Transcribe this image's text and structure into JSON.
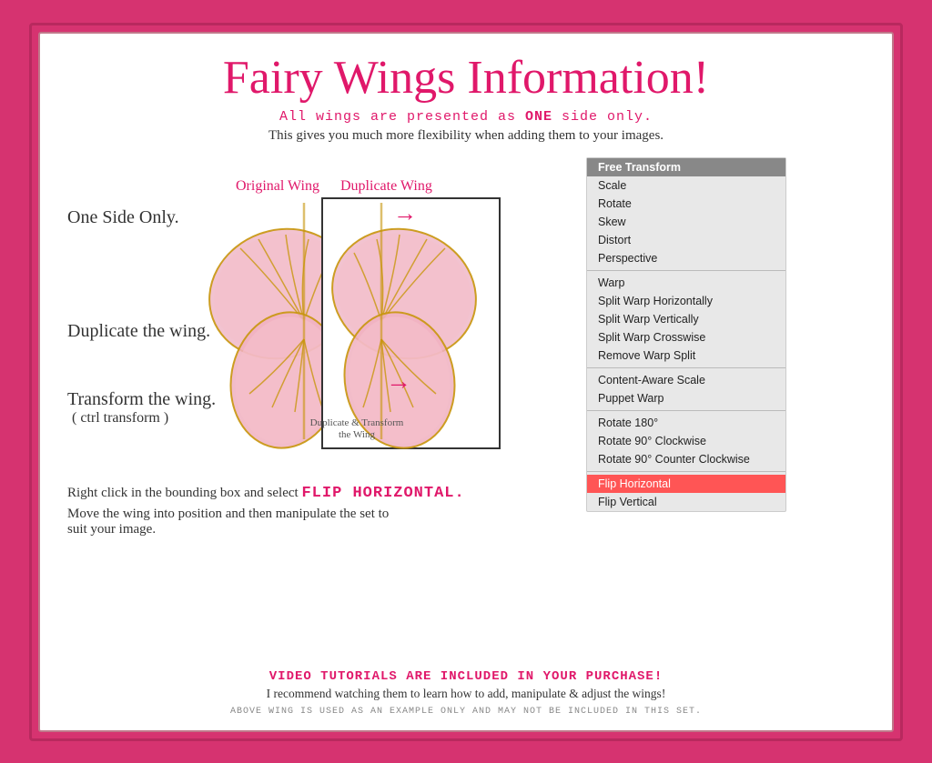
{
  "page": {
    "title": "Fairy Wings Information!",
    "subtitle": "All wings are presented as ONE side only.",
    "description": "This gives you much more flexibility when adding them to your images.",
    "labels": {
      "one_side": "One Side Only.",
      "duplicate": "Duplicate the wing.",
      "transform": "Transform the wing.",
      "transform_sub": "( ctrl transform )",
      "duplicate_transform": "Duplicate & Transform\nthe Wing"
    },
    "wing_labels": {
      "original": "Original Wing",
      "duplicate": "Duplicate Wing"
    },
    "flip_line": "Right click in the bounding box and select",
    "flip_highlight": "FLIP HORIZONTAL.",
    "move_line": "Move the wing into position and then manipulate the set to\nsuit your image.",
    "video_line": "VIDEO TUTORIALS ARE INCLUDED IN YOUR PURCHASE!",
    "recommend_line": "I recommend watching them to learn how to add, manipulate & adjust the wings!",
    "footer": "ABOVE WING IS USED AS AN EXAMPLE ONLY AND MAY NOT BE INCLUDED IN THIS SET."
  },
  "context_menu": {
    "items": [
      {
        "label": "Free Transform",
        "type": "highlighted"
      },
      {
        "label": "Scale",
        "type": "normal"
      },
      {
        "label": "Rotate",
        "type": "normal"
      },
      {
        "label": "Skew",
        "type": "normal"
      },
      {
        "label": "Distort",
        "type": "normal"
      },
      {
        "label": "Perspective",
        "type": "normal"
      },
      {
        "type": "divider"
      },
      {
        "label": "Warp",
        "type": "normal"
      },
      {
        "label": "Split Warp Horizontally",
        "type": "normal"
      },
      {
        "label": "Split Warp Vertically",
        "type": "normal"
      },
      {
        "label": "Split Warp Crosswise",
        "type": "normal"
      },
      {
        "label": "Remove Warp Split",
        "type": "normal"
      },
      {
        "type": "divider"
      },
      {
        "label": "Content-Aware Scale",
        "type": "normal"
      },
      {
        "label": "Puppet Warp",
        "type": "normal"
      },
      {
        "type": "divider"
      },
      {
        "label": "Rotate 180°",
        "type": "normal"
      },
      {
        "label": "Rotate 90° Clockwise",
        "type": "normal"
      },
      {
        "label": "Rotate 90° Counter Clockwise",
        "type": "normal"
      },
      {
        "type": "divider"
      },
      {
        "label": "Flip Horizontal",
        "type": "flip-horizontal"
      },
      {
        "label": "Flip Vertical",
        "type": "normal"
      }
    ]
  }
}
